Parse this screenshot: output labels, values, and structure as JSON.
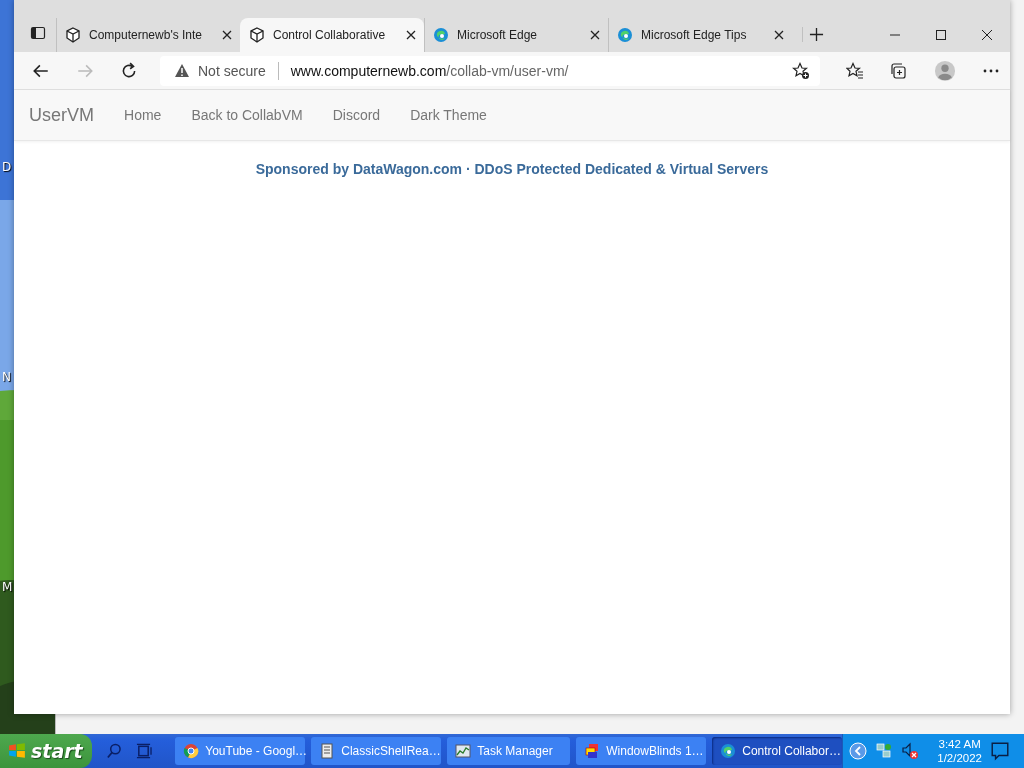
{
  "desktop_icons": [
    "D",
    "N",
    "M"
  ],
  "browser": {
    "tabs": [
      {
        "title": "Computernewb's Inte",
        "selected": false
      },
      {
        "title": "Control Collaborative",
        "selected": true
      },
      {
        "title": "Microsoft Edge",
        "selected": false
      },
      {
        "title": "Microsoft Edge Tips",
        "selected": false
      }
    ],
    "security": "Not secure",
    "url": {
      "host": "www.computernewb.com",
      "path": "/collab-vm/user-vm/"
    }
  },
  "page": {
    "brand": "UserVM",
    "nav": [
      "Home",
      "Back to CollabVM",
      "Discord",
      "Dark Theme"
    ],
    "sponsor": "Sponsored by DataWagon.com · DDoS Protected Dedicated & Virtual Servers"
  },
  "taskbar": {
    "start": "start",
    "items": [
      {
        "label": "YouTube - Googl…",
        "selected": false
      },
      {
        "label": "ClassicShellRea…",
        "selected": false
      },
      {
        "label": "Task Manager",
        "selected": false
      },
      {
        "label": "WindowBlinds 1…",
        "selected": false
      },
      {
        "label": "Control Collabor…",
        "selected": true
      }
    ],
    "time": "3:42 AM",
    "date": "1/2/2022"
  }
}
